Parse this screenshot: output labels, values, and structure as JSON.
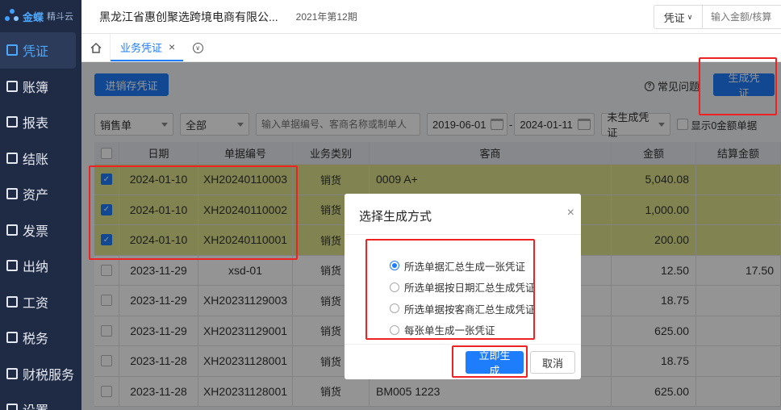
{
  "app": {
    "brand": "金蝶",
    "product": "精斗云"
  },
  "sidebar": {
    "items": [
      {
        "label": "凭证",
        "icon": "voucher-icon",
        "active": true
      },
      {
        "label": "账簿",
        "icon": "ledger-icon"
      },
      {
        "label": "报表",
        "icon": "report-icon"
      },
      {
        "label": "结账",
        "icon": "close-account-icon"
      },
      {
        "label": "资产",
        "icon": "asset-icon"
      },
      {
        "label": "发票",
        "icon": "invoice-icon"
      },
      {
        "label": "出纳",
        "icon": "cashier-icon"
      },
      {
        "label": "工资",
        "icon": "salary-icon"
      },
      {
        "label": "税务",
        "icon": "tax-icon"
      },
      {
        "label": "财税服务",
        "icon": "service-icon"
      },
      {
        "label": "设置",
        "icon": "settings-icon"
      }
    ]
  },
  "header": {
    "company": "黑龙江省惠创聚选跨境电商有限公...",
    "period": "2021年第12期",
    "search_type": "凭证",
    "search_placeholder": "输入金额/核算"
  },
  "tabs": [
    {
      "label": "业务凭证",
      "close": "×"
    }
  ],
  "toolbar": {
    "stock_voucher": "进销存凭证",
    "faq": "常见问题",
    "generate": "生成凭证"
  },
  "filters": {
    "doc_type": "销售单",
    "scope": "全部",
    "keyword_placeholder": "输入单据编号、客商名称或制单人",
    "date_from": "2019-06-01",
    "date_sep": "-",
    "date_to": "2024-01-11",
    "status": "未生成凭证",
    "show_zero": "显示0金额单据"
  },
  "table": {
    "headers": [
      "日期",
      "单据编号",
      "业务类别",
      "客商",
      "金额",
      "结算金额"
    ],
    "rows": [
      {
        "checked": true,
        "date": "2024-01-10",
        "code": "XH20240110003",
        "type": "销货",
        "partner": "0009 A+",
        "amount": "5,040.08",
        "settled": ""
      },
      {
        "checked": true,
        "date": "2024-01-10",
        "code": "XH20240110002",
        "type": "销货",
        "partner": "",
        "amount": "1,000.00",
        "settled": ""
      },
      {
        "checked": true,
        "date": "2024-01-10",
        "code": "XH20240110001",
        "type": "销货",
        "partner": "",
        "amount": "200.00",
        "settled": ""
      },
      {
        "checked": false,
        "date": "2023-11-29",
        "code": "xsd-01",
        "type": "销货",
        "partner": "",
        "amount": "12.50",
        "settled": "17.50"
      },
      {
        "checked": false,
        "date": "2023-11-29",
        "code": "XH20231129003",
        "type": "销货",
        "partner": "",
        "amount": "18.75",
        "settled": ""
      },
      {
        "checked": false,
        "date": "2023-11-29",
        "code": "XH20231129001",
        "type": "销货",
        "partner": "",
        "amount": "625.00",
        "settled": ""
      },
      {
        "checked": false,
        "date": "2023-11-28",
        "code": "XH20231128001",
        "type": "销货",
        "partner": "",
        "amount": "18.75",
        "settled": ""
      },
      {
        "checked": false,
        "date": "2023-11-28",
        "code": "XH20231128001",
        "type": "销货",
        "partner": "BM005 1223",
        "amount": "625.00",
        "settled": ""
      }
    ]
  },
  "dialog": {
    "title": "选择生成方式",
    "close": "×",
    "options": [
      {
        "label": "所选单据汇总生成一张凭证",
        "selected": true
      },
      {
        "label": "所选单据按日期汇总生成凭证",
        "selected": false
      },
      {
        "label": "所选单据按客商汇总生成凭证",
        "selected": false
      },
      {
        "label": "每张单生成一张凭证",
        "selected": false
      }
    ],
    "ok": "立即生成",
    "cancel": "取消"
  },
  "colors": {
    "accent": "#1e7dfa",
    "sidebar": "#1f2a44",
    "highlight": "#ee2222",
    "selected_row": "#dfe38a"
  }
}
